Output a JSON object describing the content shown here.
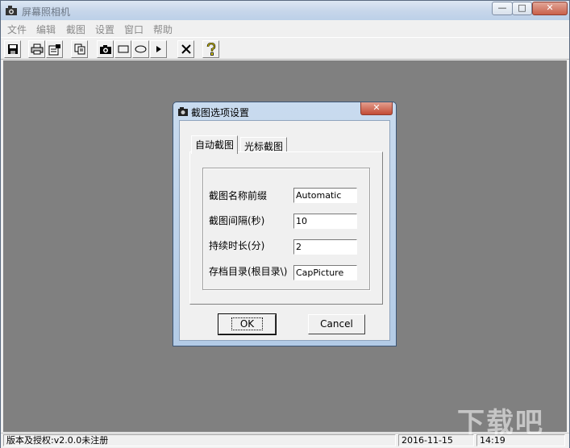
{
  "window": {
    "title": "屏幕照相机",
    "icon": "camera-icon",
    "controls": {
      "minimize": "—",
      "maximize": "□",
      "close": "✕"
    }
  },
  "menu": [
    "文件",
    "编辑",
    "截图",
    "设置",
    "窗口",
    "帮助"
  ],
  "toolbar": [
    {
      "name": "save-icon"
    },
    {
      "name": "print-icon"
    },
    {
      "name": "properties-icon"
    },
    {
      "name": "copy-icon"
    },
    {
      "name": "camera-icon"
    },
    {
      "name": "rectangle-icon"
    },
    {
      "name": "ellipse-icon"
    },
    {
      "name": "play-arrow-icon"
    },
    {
      "name": "delete-x-icon"
    },
    {
      "name": "help-question-icon"
    }
  ],
  "dialog": {
    "title": "截图选项设置",
    "close": "✕",
    "tabs": [
      "自动截图",
      "光标截图"
    ],
    "fields": [
      {
        "label": "截图名称前缀",
        "value": "Automatic"
      },
      {
        "label": "截图间隔(秒)",
        "value": "10"
      },
      {
        "label": "持续时长(分)",
        "value": "2"
      },
      {
        "label": "存档目录(根目录\\)",
        "value": "CapPicture"
      }
    ],
    "ok_label": "OK",
    "cancel_label": "Cancel"
  },
  "status": {
    "info": "版本及授权:v2.0.0未注册",
    "date": "2016-11-15",
    "time": "14:19"
  },
  "watermark": "下载吧"
}
